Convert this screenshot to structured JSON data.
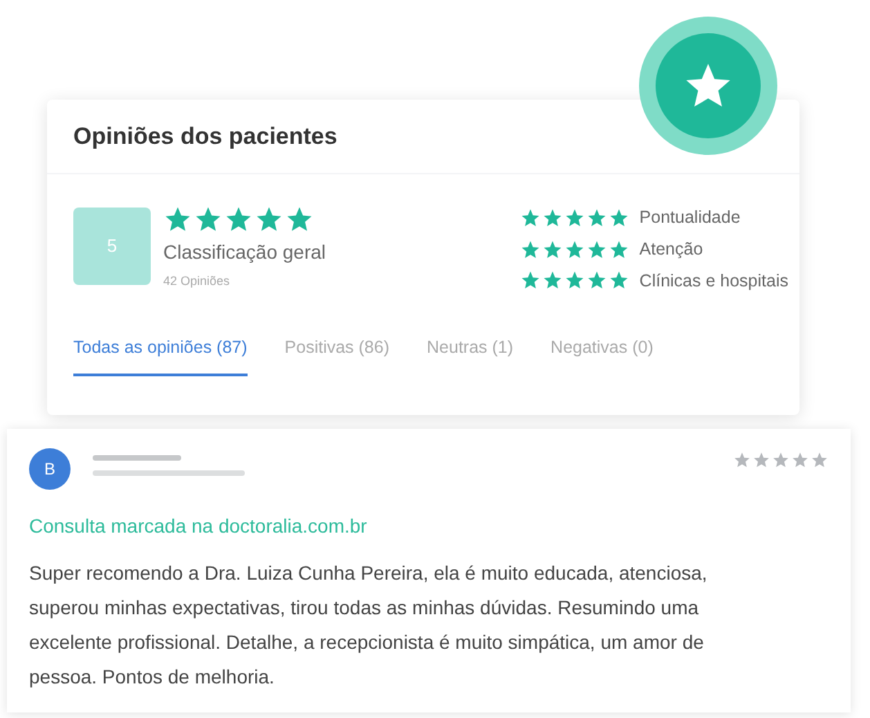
{
  "header": {
    "title": "Opiniões dos pacientes"
  },
  "summary": {
    "score": "5",
    "stars": 5,
    "label": "Classificação geral",
    "count": "42 Opiniões"
  },
  "categories": [
    {
      "label": "Pontualidade",
      "stars": 5
    },
    {
      "label": "Atenção",
      "stars": 5
    },
    {
      "label": "Clínicas e hospitais",
      "stars": 5
    }
  ],
  "tabs": [
    {
      "label": "Todas as opiniões (87)",
      "selected": true
    },
    {
      "label": "Positivas (86)",
      "selected": false
    },
    {
      "label": "Neutras (1)",
      "selected": false
    },
    {
      "label": "Negativas (0)",
      "selected": false
    }
  ],
  "review": {
    "avatar": "B",
    "stars": 0,
    "source": "Consulta marcada na doctoralia.com.br",
    "text": "Super recomendo a Dra. Luiza Cunha Pereira, ela é muito educada, atenciosa, superou minhas expectativas, tirou todas as minhas dúvidas. Resumindo uma excelente profissional. Detalhe, a recepcionista é muito simpática, um amor de pessoa. Pontos de melhoria."
  }
}
